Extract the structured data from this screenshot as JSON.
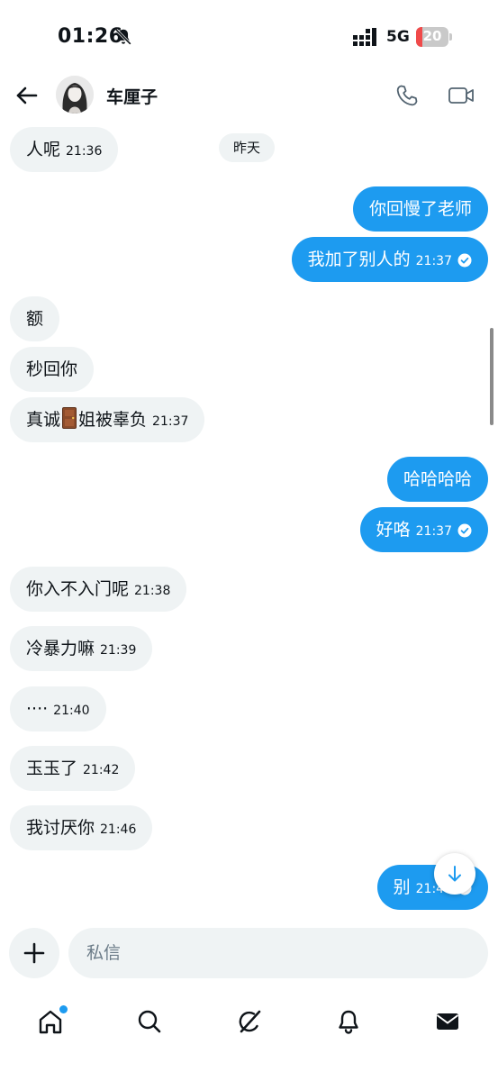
{
  "status_bar": {
    "time": "01:26",
    "network": "5G",
    "battery": "20",
    "battery_level": 0.2,
    "icons": [
      "bell-muted-icon",
      "signal-icon",
      "battery-icon"
    ]
  },
  "header": {
    "contact_name": "车厘子",
    "icons": [
      "back-arrow-icon",
      "avatar",
      "phone-icon",
      "video-icon"
    ]
  },
  "chat": {
    "date_separator": "昨天",
    "messages": [
      {
        "dir": "in",
        "text": "人呢",
        "time": "21:36"
      },
      {
        "dir": "out",
        "text": "你回慢了老师",
        "time": ""
      },
      {
        "dir": "out",
        "text": "我加了别人的",
        "time": "21:37",
        "read": true
      },
      {
        "dir": "in",
        "text": "额",
        "time": ""
      },
      {
        "dir": "in",
        "text": "秒回你",
        "time": ""
      },
      {
        "dir": "in",
        "text_before": "真诚",
        "emoji": "door-emoji",
        "text_after": "姐被辜负",
        "time": "21:37"
      },
      {
        "dir": "out",
        "text": "哈哈哈哈",
        "time": ""
      },
      {
        "dir": "out",
        "text": "好咯",
        "time": "21:37",
        "read": true
      },
      {
        "dir": "in",
        "text": "你入不入门呢",
        "time": "21:38"
      },
      {
        "dir": "in",
        "text": "冷暴力嘛",
        "time": "21:39"
      },
      {
        "dir": "in",
        "text": "····",
        "time": "21:40"
      },
      {
        "dir": "in",
        "text": "玉玉了",
        "time": "21:42"
      },
      {
        "dir": "in",
        "text": "我讨厌你",
        "time": "21:46"
      },
      {
        "dir": "out",
        "text": "别",
        "time": "21:46",
        "read": true
      }
    ]
  },
  "composer": {
    "placeholder": "私信"
  },
  "bottom_nav": {
    "items": [
      "home-icon",
      "search-icon",
      "grok-icon",
      "notifications-icon",
      "messages-icon"
    ]
  },
  "colors": {
    "accent": "#1d9bf0",
    "incoming_bubble": "#eff3f4",
    "text": "#0f1419",
    "battery_low": "#f04a4a"
  }
}
